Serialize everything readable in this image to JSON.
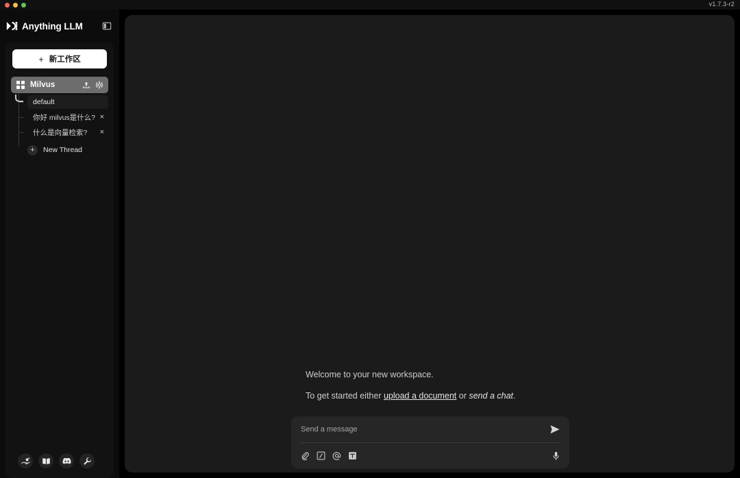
{
  "titlebar": {
    "version": "v1.7.3-r2",
    "window_controls": [
      "close",
      "minimize",
      "maximize"
    ]
  },
  "sidebar": {
    "brand": "Anything LLM",
    "logo_icon": "anythingllm-logo-icon",
    "panel_toggle_icon": "sidebar-toggle-icon",
    "new_workspace": {
      "label": "新工作区",
      "plus": "+"
    },
    "workspace": {
      "name": "Milvus",
      "grid_icon": "grid-squares-icon",
      "upload_icon": "upload-icon",
      "settings_icon": "gear-icon"
    },
    "threads": [
      {
        "label": "default",
        "active": true,
        "closable": false
      },
      {
        "label": "你好 milvus是什么?",
        "active": false,
        "closable": true,
        "close": "×"
      },
      {
        "label": "什么是向量检索?",
        "active": false,
        "closable": true,
        "close": "×"
      }
    ],
    "new_thread": {
      "label": "New Thread",
      "plus": "+"
    },
    "footer_buttons": [
      {
        "name": "support-icon",
        "title": "Support"
      },
      {
        "name": "docs-book-icon",
        "title": "Docs"
      },
      {
        "name": "discord-icon",
        "title": "Discord"
      },
      {
        "name": "wrench-settings-icon",
        "title": "Settings"
      }
    ]
  },
  "main": {
    "welcome_line1": "Welcome to your new workspace.",
    "welcome_prefix": "To get started either ",
    "upload_link": "upload a document",
    "welcome_middle": " or ",
    "chat_link": "send a chat",
    "welcome_suffix": ".",
    "composer": {
      "placeholder": "Send a message",
      "value": "",
      "send_icon": "send-arrow-icon",
      "attach_icon": "paperclip-icon",
      "slash_icon": "slash-command-icon",
      "mention_icon": "at-mention-icon",
      "text_icon": "text-format-icon",
      "mic_icon": "microphone-icon"
    }
  },
  "colors": {
    "app_background": "#000000",
    "sidebar_background": "#0c0c0c",
    "sidebar_panel": "#121212",
    "main_panel": "#1b1b1b",
    "composer": "#262626",
    "workspace_active": "#6d6d6d",
    "accent_white": "#ffffff"
  }
}
